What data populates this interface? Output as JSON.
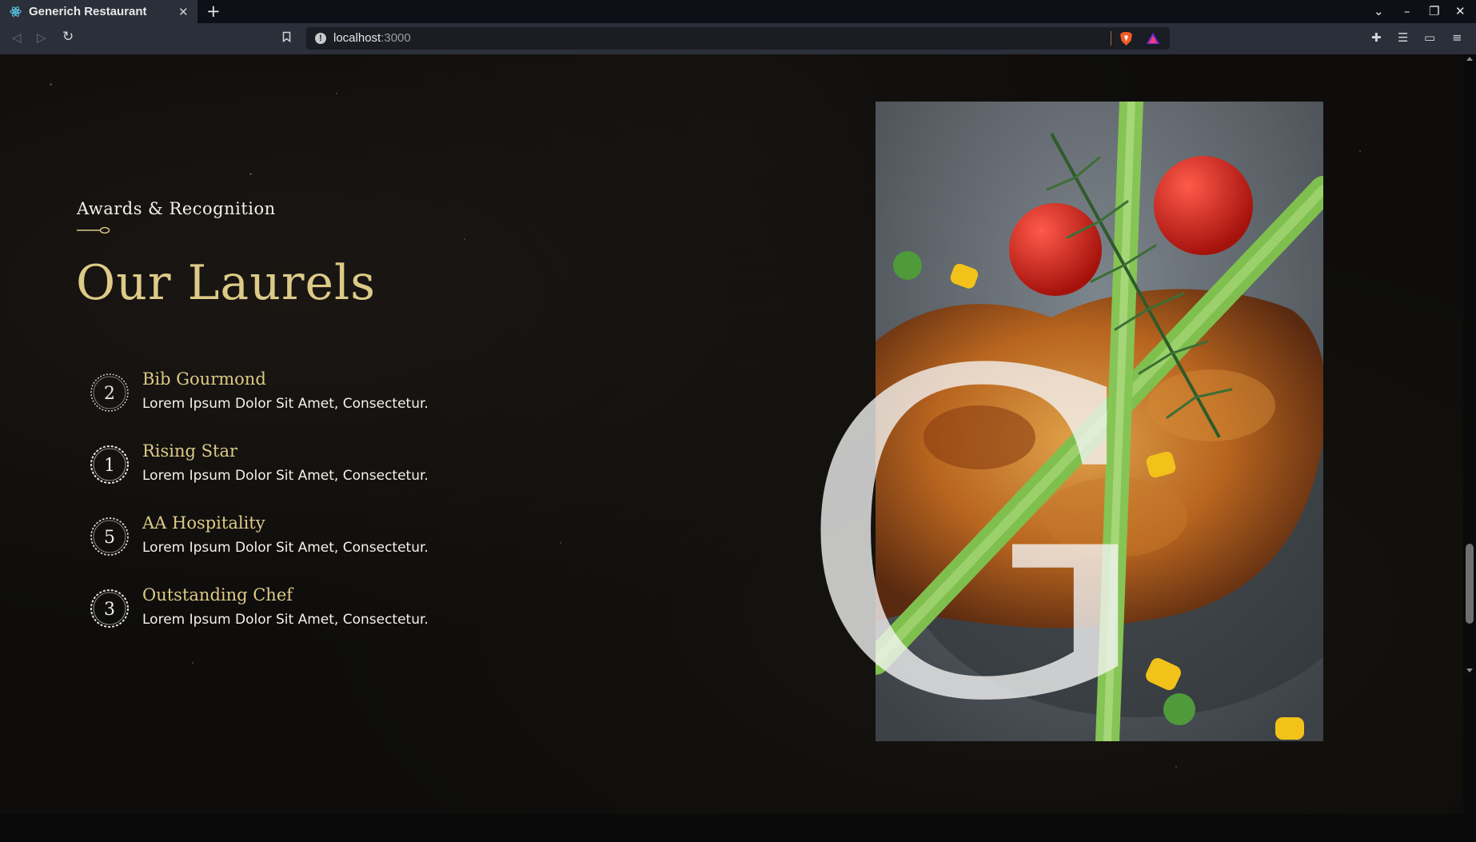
{
  "browser": {
    "tab_title": "Generich Restaurant",
    "url_host": "localhost",
    "url_port": ":3000"
  },
  "colors": {
    "accent_gold": "#dcca87",
    "text_white": "#f4f1ea",
    "background": "#0e0d0b"
  },
  "section": {
    "subtitle": "Awards & Recognition",
    "title": "Our Laurels",
    "awards": [
      {
        "number": "2",
        "title": "Bib Gourmond",
        "desc": "Lorem Ipsum Dolor Sit Amet, Consectetur.",
        "icon": "laurel-badge-icon"
      },
      {
        "number": "1",
        "title": "Rising Star",
        "desc": "Lorem Ipsum Dolor Sit Amet, Consectetur.",
        "icon": "laurel-badge-icon"
      },
      {
        "number": "5",
        "title": "AA Hospitality",
        "desc": "Lorem Ipsum Dolor Sit Amet, Consectetur.",
        "icon": "laurel-badge-icon"
      },
      {
        "number": "3",
        "title": "Outstanding Chef",
        "desc": "Lorem Ipsum Dolor Sit Amet, Consectetur.",
        "icon": "laurel-badge-icon"
      }
    ],
    "watermark_letter": "G"
  }
}
